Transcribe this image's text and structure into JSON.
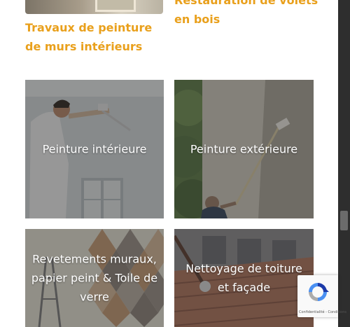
{
  "cards": [
    {
      "title": "Travaux de peinture de murs intérieurs"
    },
    {
      "title": "Restauration de volets en bois"
    }
  ],
  "tiles": [
    {
      "label": "Peinture intérieure"
    },
    {
      "label": "Peinture extérieure"
    },
    {
      "label": "Revetements muraux, papier peint & Toile de verre"
    },
    {
      "label": "Nettoyage de toiture et façade"
    }
  ],
  "recaptcha": {
    "links": "Confidentialité - Conditions"
  },
  "colors": {
    "accent": "#e9a01c",
    "overlay": "#3a3a3a",
    "scrollbar": "#2e2e2e"
  },
  "icons": {
    "badge": "recaptcha-icon"
  },
  "scroll": {
    "position": 0.66
  }
}
